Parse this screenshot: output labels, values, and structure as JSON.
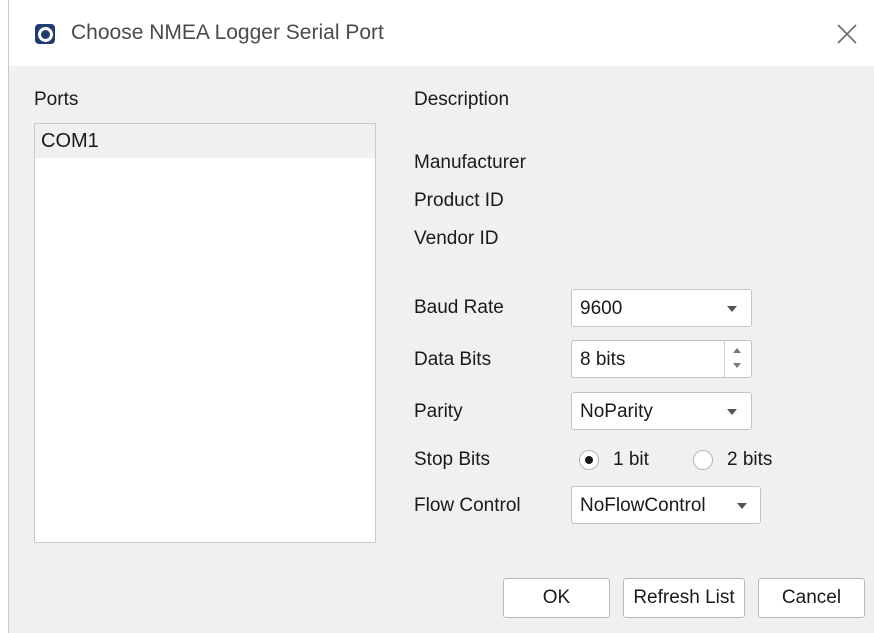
{
  "window": {
    "title": "Choose NMEA Logger Serial Port"
  },
  "ports": {
    "header": "Ports",
    "items": [
      "COM1"
    ],
    "selected": "COM1"
  },
  "description": {
    "header": "Description",
    "manufacturer_label": "Manufacturer",
    "product_id_label": "Product ID",
    "vendor_id_label": "Vendor ID"
  },
  "settings": {
    "baud_rate": {
      "label": "Baud Rate",
      "value": "9600"
    },
    "data_bits": {
      "label": "Data Bits",
      "value": "8 bits"
    },
    "parity": {
      "label": "Parity",
      "value": "NoParity"
    },
    "stop_bits": {
      "label": "Stop Bits",
      "options": [
        "1 bit",
        "2 bits"
      ],
      "selected": "1 bit"
    },
    "flow_control": {
      "label": "Flow Control",
      "value": "NoFlowControl"
    }
  },
  "buttons": {
    "ok": "OK",
    "refresh": "Refresh List",
    "cancel": "Cancel"
  },
  "icons": {
    "app": "app-logo-icon",
    "close": "close-icon"
  }
}
